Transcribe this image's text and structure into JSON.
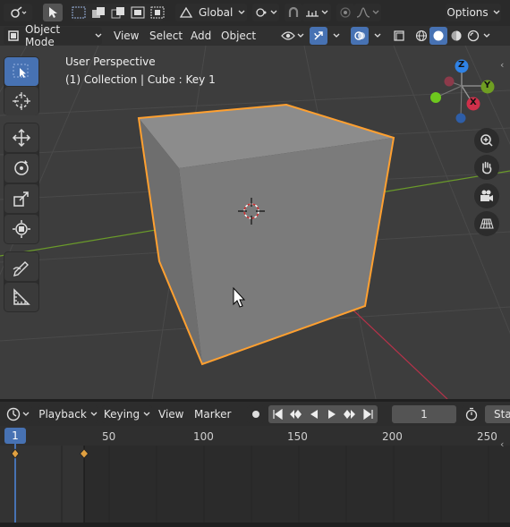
{
  "header": {
    "transform_orientation": "Global",
    "options_label": "Options"
  },
  "viewport_header": {
    "mode_label": "Object Mode",
    "menus": [
      "View",
      "Select",
      "Add",
      "Object"
    ]
  },
  "viewport": {
    "perspective_label": "User Perspective",
    "object_info": "(1) Collection | Cube : Key 1",
    "gizmo_axes": [
      "Z",
      "Y",
      "X"
    ],
    "colors": {
      "x_axis": "#d0304a",
      "y_axis": "#7fb82a",
      "z_axis": "#2f82e5",
      "selection": "#ffa030"
    }
  },
  "tools": [
    "select-box",
    "cursor",
    "move",
    "rotate",
    "scale",
    "transform",
    "annotate",
    "measure"
  ],
  "timeline": {
    "menus": [
      "Playback",
      "Keying",
      "View",
      "Marker"
    ],
    "current_frame": "1",
    "start_label": "Sta",
    "ruler": [
      "1",
      "50",
      "100",
      "150",
      "200",
      "250"
    ],
    "keyframes": [
      1,
      19
    ]
  }
}
